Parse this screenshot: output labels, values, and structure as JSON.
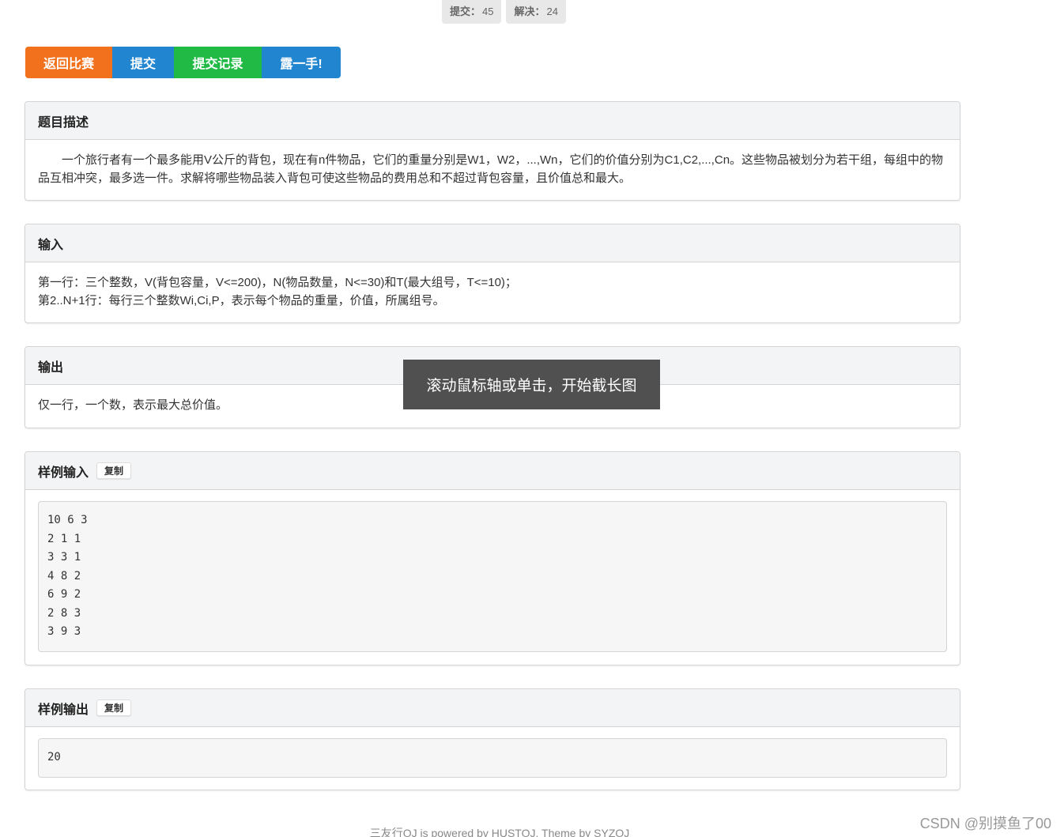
{
  "stats": {
    "submit_label": "提交：",
    "submit_value": "45",
    "solved_label": "解决：",
    "solved_value": "24"
  },
  "buttons": {
    "back": "返回比赛",
    "submit": "提交",
    "records": "提交记录",
    "show": "露一手!"
  },
  "colors": {
    "orange": "#f2711c",
    "blue": "#2185d0",
    "green": "#21ba45"
  },
  "description": {
    "title": "题目描述",
    "text": "一个旅行者有一个最多能用V公斤的背包，现在有n件物品，它们的重量分别是W1，W2，...,Wn，它们的价值分别为C1,C2,...,Cn。这些物品被划分为若干组，每组中的物品互相冲突，最多选一件。求解将哪些物品装入背包可使这些物品的费用总和不超过背包容量，且价值总和最大。"
  },
  "input": {
    "title": "输入",
    "line1": "第一行：三个整数，V(背包容量，V<=200)，N(物品数量，N<=30)和T(最大组号，T<=10)；",
    "line2": "第2..N+1行：每行三个整数Wi,Ci,P，表示每个物品的重量，价值，所属组号。"
  },
  "output": {
    "title": "输出",
    "text": "仅一行，一个数，表示最大总价值。"
  },
  "sample_input": {
    "title": "样例输入",
    "copy_label": "复制",
    "code": "10 6 3\n2 1 1\n3 3 1\n4 8 2\n6 9 2\n2 8 3\n3 9 3"
  },
  "sample_output": {
    "title": "样例输出",
    "copy_label": "复制",
    "code": "20"
  },
  "tooltip": "滚动鼠标轴或单击，开始截长图",
  "footer": "三友行OJ is powered by HUSTOJ. Theme by SYZOJ",
  "watermark": "CSDN @别摸鱼了00"
}
